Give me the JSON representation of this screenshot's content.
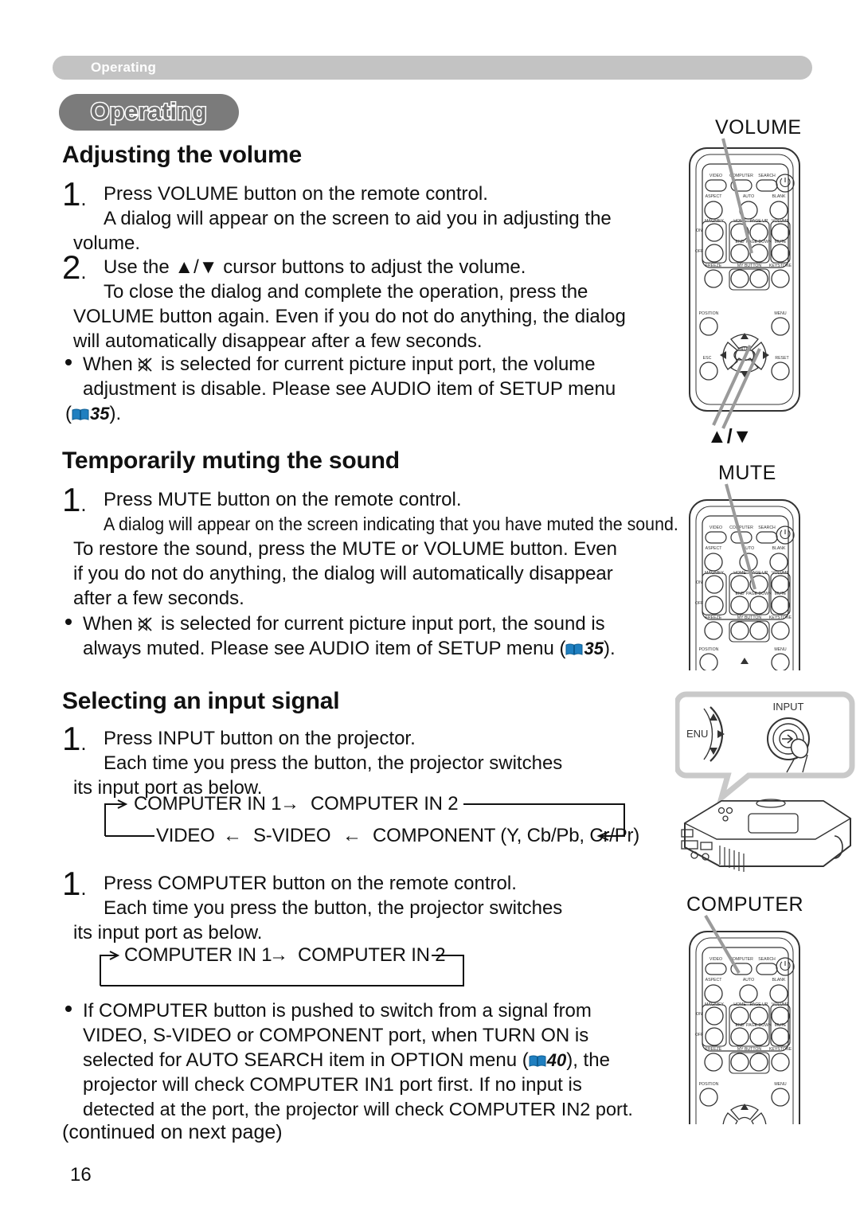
{
  "running_head": "Operating",
  "section_pill": "Operating",
  "sections": [
    {
      "heading": "Adjusting the volume",
      "steps": [
        {
          "number": "1",
          "lines": [
            "Press VOLUME button on the remote control.",
            "A dialog will appear on the screen to aid you in adjusting the",
            "volume."
          ]
        },
        {
          "number": "2",
          "lines": [
            "Use the ▲/▼ cursor buttons to adjust the volume.",
            "To close the dialog and complete the operation, press the",
            "VOLUME button again. Even if you do not do anything, the dialog",
            "will automatically disappear after a few seconds."
          ]
        }
      ],
      "bullets": [
        {
          "pre": "When",
          "icon": "mute-icon",
          "post": "is selected for current picture input port, the volume",
          "line2": "adjustment is disable. Please see AUDIO item of SETUP menu",
          "line3_open": "(",
          "page_ref": "35",
          "line3_close": ")."
        }
      ]
    },
    {
      "heading": "Temporarily muting the sound",
      "steps": [
        {
          "number": "1",
          "lines": [
            "Press MUTE button on the remote control.",
            "A dialog will appear on the screen indicating that you have muted the sound.",
            "To restore the sound, press the MUTE or VOLUME button. Even",
            "if you do not do anything, the dialog will automatically disappear",
            "after a few seconds."
          ]
        }
      ],
      "bullets": [
        {
          "pre": "When",
          "icon": "mute-icon",
          "post": "is selected for current picture input port, the sound is",
          "line2_pre": "always muted. Please see AUDIO item of SETUP menu (",
          "page_ref": "35",
          "line2_post": ")."
        }
      ]
    },
    {
      "heading": "Selecting an input signal",
      "steps": [
        {
          "number": "1",
          "lines": [
            "Press INPUT button on the projector.",
            "Each time you press the button, the projector switches",
            "its input port as below."
          ]
        },
        {
          "number": "1",
          "lines": [
            "Press COMPUTER button on the remote control.",
            "Each time you press the button, the projector switches",
            "its input port as below."
          ]
        }
      ],
      "bullets": [
        {
          "line1": "If COMPUTER button is pushed to switch from a signal from",
          "line2": "VIDEO, S-VIDEO or COMPONENT port, when TURN ON is",
          "line3_pre": "selected for AUTO SEARCH item in OPTION menu (",
          "page_ref": "40",
          "line3_post": "), the",
          "line4": "projector will check COMPUTER IN1 port first. If no input is",
          "line5": "detected at the port, the projector will check COMPUTER IN2 port."
        }
      ]
    }
  ],
  "flow_projector": {
    "row1_arrow_in": "→",
    "row1_a": "COMPUTER IN 1",
    "row1_arrow": "→",
    "row1_b": "COMPUTER IN 2",
    "row2_a": "VIDEO",
    "row2_arrow1": "←",
    "row2_b": "S-VIDEO",
    "row2_arrow2": "←",
    "row2_c": "COMPONENT (Y, Cb/Pb, Cr/Pr)",
    "row2_arrow_in": "←"
  },
  "flow_computer": {
    "arrow_in": "→",
    "a": "COMPUTER IN 1",
    "arrow": "→",
    "b": "COMPUTER IN 2"
  },
  "footer": {
    "continued": "(continued on next page)",
    "page_number": "16"
  },
  "illustrations": {
    "volume_label": "VOLUME",
    "updown_label": "▲/▼",
    "mute_label": "MUTE",
    "input_label": "INPUT",
    "computer_label": "COMPUTER",
    "projector_menu_label": "ENU"
  },
  "remote": {
    "row1": [
      "VIDEO",
      "COMPUTER",
      "SEARCH"
    ],
    "row2": [
      "ASPECT",
      "AUTO",
      "BLANK"
    ],
    "magnify": "MAGNIFY",
    "magnify_on": "ON",
    "magnify_off": "OFF",
    "pad": [
      "HOME",
      "PAGE UP",
      "END",
      "PAGE DOWN"
    ],
    "right_col": [
      "VOLUME",
      "MUTE"
    ],
    "row_bottom": [
      "FREEZE",
      "MY BUTTON",
      "KEYSTONE"
    ],
    "mybtn1": "1",
    "mybtn2": "2",
    "nav": [
      "POSITION",
      "MENU",
      "ESC",
      "RESET"
    ],
    "enter": "ENTER"
  },
  "colors": {
    "runhead_bg": "#c3c3c3",
    "pill_bg": "#7b7b7b",
    "book_icon": "#1f7fc0",
    "text": "#111111",
    "leader_line": "#9a9a9a"
  }
}
